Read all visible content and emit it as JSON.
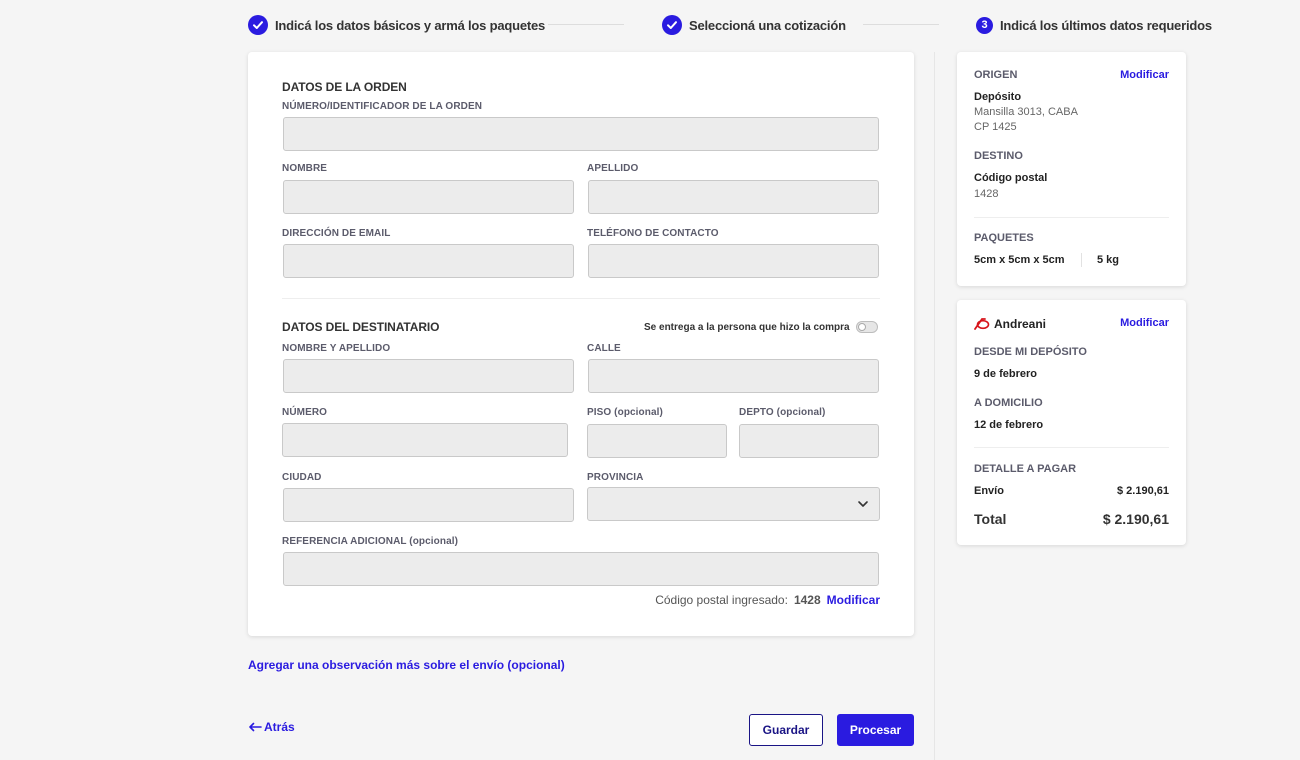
{
  "stepper": {
    "steps": [
      {
        "label": "Indicá los datos básicos y armá los paquetes",
        "state": "done"
      },
      {
        "label": "Seleccioná una cotización",
        "state": "done"
      },
      {
        "number": "3",
        "label": "Indicá los últimos datos requeridos",
        "state": "current"
      }
    ]
  },
  "order": {
    "title": "DATOS DE LA ORDEN",
    "id_label": "NÚMERO/IDENTIFICADOR DE LA ORDEN",
    "id_value": "",
    "first_name_label": "NOMBRE",
    "first_name_value": "",
    "last_name_label": "APELLIDO",
    "last_name_value": "",
    "email_label": "DIRECCIÓN DE EMAIL",
    "email_value": "",
    "phone_label": "TELÉFONO DE CONTACTO",
    "phone_value": ""
  },
  "recipient": {
    "title": "DATOS DEL DESTINATARIO",
    "toggle_label": "Se entrega a la persona que hizo la compra",
    "toggle_on": false,
    "full_name_label": "NOMBRE Y APELLIDO",
    "full_name_value": "",
    "street_label": "CALLE",
    "street_value": "",
    "number_label": "NÚMERO",
    "number_value": "",
    "floor_label": "PISO (opcional)",
    "floor_value": "",
    "apt_label": "DEPTO (opcional)",
    "apt_value": "",
    "city_label": "CIUDAD",
    "city_value": "",
    "province_label": "PROVINCIA",
    "province_value": "",
    "reference_label": "REFERENCIA ADICIONAL (opcional)",
    "reference_value": "",
    "postal_code_label": "Código postal ingresado:",
    "postal_code_value": "1428",
    "postal_code_modify": "Modificar"
  },
  "observation_link": "Agregar una observación más sobre el envío (opcional)",
  "footer": {
    "back_label": "Atrás",
    "save_label": "Guardar",
    "process_label": "Procesar"
  },
  "summary": {
    "origin_head": "ORIGEN",
    "modify": "Modificar",
    "origin_name": "Depósito",
    "origin_address": "Mansilla 3013, CABA",
    "origin_cp": "CP 1425",
    "destination_head": "DESTINO",
    "destination_name": "Código postal",
    "destination_cp": "1428",
    "packages_head": "PAQUETES",
    "package_dims": "5cm x 5cm x 5cm",
    "package_weight": "5 kg"
  },
  "quote": {
    "carrier": "Andreani",
    "modify": "Modificar",
    "from_head": "DESDE MI DEPÓSITO",
    "from_date": "9 de febrero",
    "to_head": "A DOMICILIO",
    "to_date": "12 de febrero",
    "detail_head": "DETALLE A PAGAR",
    "shipping_label": "Envío",
    "shipping_value": "$ 2.190,61",
    "total_label": "Total",
    "total_value": "$ 2.190,61"
  },
  "colors": {
    "accent": "#2a1be0",
    "dark_accent": "#1a1485",
    "carrier_red": "#d7141b"
  }
}
